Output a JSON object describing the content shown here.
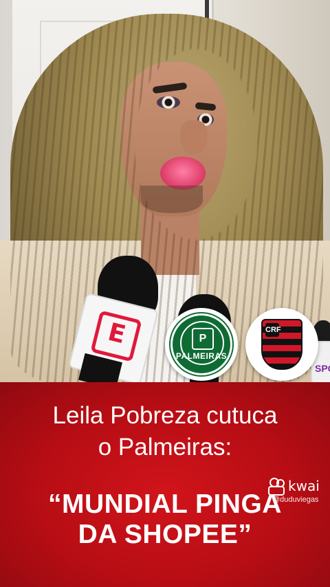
{
  "headline": {
    "line1": "Leila Pobreza cutuca",
    "line2": "o Palmeiras:"
  },
  "quote": {
    "line1": "“MUNDIAL PINGA",
    "line2": "DA SHOPEE”"
  },
  "watermark": {
    "brand": "kwai",
    "handle": "@duduviegas"
  },
  "badges": {
    "palmeiras": {
      "label": "PALMEIRAS",
      "monogram": "P",
      "color": "#0f6b34"
    },
    "flamengo": {
      "monogram": "CRF",
      "colors": [
        "#d0182a",
        "#111111"
      ]
    }
  },
  "microphones": {
    "espn_logo": "E",
    "espn_color": "#e0193b",
    "partial_logo": "SPO"
  },
  "colors": {
    "caption_band": "#c4101a",
    "text": "#ffffff"
  }
}
